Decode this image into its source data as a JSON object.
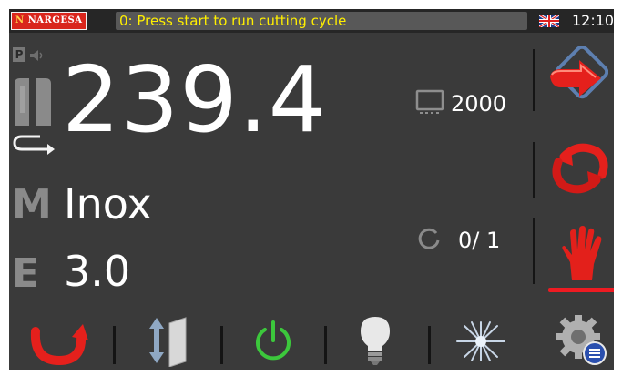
{
  "header": {
    "logo_text": "NARGESA",
    "status_message": "0: Press start to run cutting cycle",
    "time": "12:10"
  },
  "main": {
    "length": "239.4",
    "material": "Inox",
    "thickness": "3.0",
    "left_letters": {
      "material": "M",
      "thickness": "E",
      "program": "P"
    },
    "target_quantity": "2000",
    "cycle_counter": "0/ 1"
  },
  "icons": {
    "top": [
      "program-badge",
      "speaker-icon",
      "blade-icon",
      "u-turn-arrow-icon"
    ],
    "right": [
      "run-arrow-button",
      "cycle-loop-button",
      "manual-hand-button"
    ],
    "bottom": [
      "return-arrow-button",
      "clamp-up-down-button",
      "power-button",
      "light-bulb-button",
      "laser-button",
      "settings-button"
    ]
  },
  "colors": {
    "background": "#3a3a3a",
    "status_text": "#ffef00",
    "accent_red": "#ee1b22",
    "power_green": "#3cc83c"
  }
}
